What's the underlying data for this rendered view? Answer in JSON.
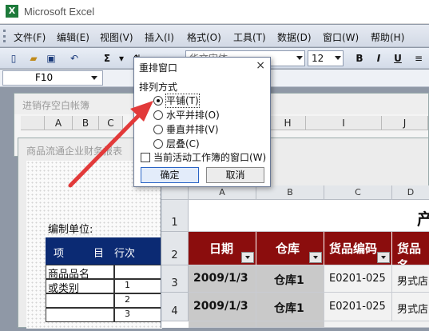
{
  "app": {
    "title": "Microsoft Excel",
    "icon_letter": "X"
  },
  "menu": [
    {
      "label": "文件(F)"
    },
    {
      "label": "编辑(E)"
    },
    {
      "label": "视图(V)"
    },
    {
      "label": "插入(I)"
    },
    {
      "label": "格式(O)"
    },
    {
      "label": "工具(T)"
    },
    {
      "label": "数据(D)"
    },
    {
      "label": "窗口(W)"
    },
    {
      "label": "帮助(H)"
    }
  ],
  "toolbar": {
    "sigma": "Σ",
    "font_size": "12",
    "bold": "B",
    "italic": "I",
    "underline": "U",
    "font_name_fragment": "华文宋体"
  },
  "formula": {
    "cell_ref": "F10"
  },
  "windows": {
    "back_title": "进销存空白帐簿",
    "back_cols": [
      "A",
      "B",
      "C",
      "H",
      "I",
      "J"
    ],
    "mid_title": "商品流通企业财务报表",
    "mid_label": "编制单位:",
    "mid_header": [
      "项",
      "目",
      "行次"
    ],
    "mid_rows": [
      {
        "item": "商品品名",
        "num": ""
      },
      {
        "item": "或类别",
        "num": "1"
      },
      {
        "item": "",
        "num": "2"
      },
      {
        "item": "",
        "num": "3"
      }
    ]
  },
  "sheet": {
    "col_headers": [
      "A",
      "B",
      "C",
      "D"
    ],
    "row_headers": [
      "1",
      "2",
      "3",
      "4"
    ],
    "title_fragment": "产",
    "header_row": [
      "日期",
      "仓库",
      "货品编码",
      "货品名"
    ],
    "rows": [
      [
        "2009/1/3",
        "仓库1",
        "E0201-025",
        "男式店"
      ],
      [
        "2009/1/3",
        "仓库1",
        "E0201-025",
        "男式店"
      ]
    ]
  },
  "dialog": {
    "title": "重排窗口",
    "close": "×",
    "group_label": "排列方式",
    "options": [
      {
        "label": "平铺(T)",
        "selected": true
      },
      {
        "label": "水平并排(O)",
        "selected": false
      },
      {
        "label": "垂直并排(V)",
        "selected": false
      },
      {
        "label": "层叠(C)",
        "selected": false
      }
    ],
    "checkbox_label": "当前活动工作簿的窗口(W)",
    "ok": "确定",
    "cancel": "取消"
  },
  "colors": {
    "header_red": "#8b0d0d",
    "mid_header_blue": "#0b2a73",
    "arrow": "#e23a3a"
  }
}
